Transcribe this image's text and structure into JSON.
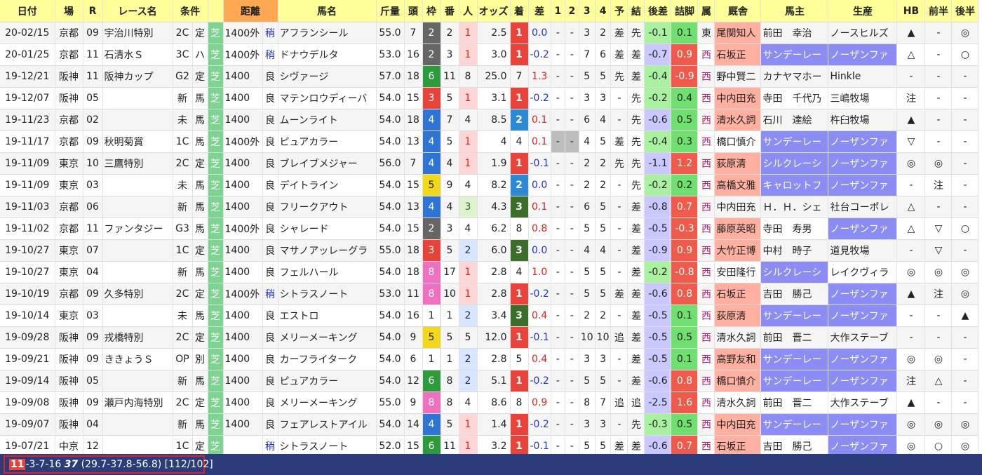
{
  "headers": {
    "date": "日付",
    "place": "場",
    "race_no": "R",
    "race_name": "レース名",
    "cond": "条件",
    "dist": "距離",
    "horse": "馬名",
    "weight": "斤量",
    "heads": "頭",
    "frame": "枠",
    "num": "番",
    "pop": "人",
    "odds": "オッズ",
    "finish": "着",
    "diff": "差",
    "c1": "1",
    "c2": "2",
    "c3": "3",
    "c4": "4",
    "pred": "予",
    "result": "結",
    "late_diff": "後差",
    "agari": "詰脚",
    "belong": "属",
    "stable": "厩舎",
    "owner": "馬主",
    "breeder": "生産",
    "hb": "HB",
    "first_half": "前半",
    "second_half": "後半"
  },
  "rows": [
    {
      "date": "20-02/15",
      "place": "京都",
      "r": "09",
      "name": "宇治川特別",
      "grade": "2C",
      "kind": "定",
      "surface": "芝",
      "dist": "1400外",
      "track": "稍",
      "horse": "アフランシール",
      "weight": "55.0",
      "heads": "7",
      "frame": "2",
      "num": "2",
      "pop": "1",
      "odds": "2.5",
      "finish": "1",
      "diff": "0.0",
      "c1": "-",
      "c2": "-",
      "c3": "3",
      "c4": "2",
      "pred": "差",
      "result": "先",
      "late": "-0.1",
      "agari": "0.1",
      "belong": "東",
      "stable": "尾関知人",
      "owner": "前田　幸治",
      "breeder": "ノースヒルズ",
      "hb": "▲",
      "fh": "-",
      "sh": "◎"
    },
    {
      "date": "20-01/25",
      "place": "京都",
      "r": "11",
      "name": "石清水Ｓ",
      "grade": "3C",
      "kind": "ハ",
      "surface": "芝",
      "dist": "1400外",
      "track": "稍",
      "horse": "ドナウデルタ",
      "weight": "53.0",
      "heads": "16",
      "frame": "2",
      "num": "3",
      "pop": "1",
      "odds": "3.0",
      "finish": "1",
      "diff": "-0.2",
      "c1": "-",
      "c2": "-",
      "c3": "7",
      "c4": "6",
      "pred": "差",
      "result": "差",
      "late": "-0.7",
      "agari": "0.9",
      "belong": "西",
      "stable": "石坂正",
      "owner": "サンデーレー",
      "breeder": "ノーザンファ",
      "hb": "△",
      "fh": "-",
      "sh": "○"
    },
    {
      "date": "19-12/21",
      "place": "阪神",
      "r": "11",
      "name": "阪神カップ",
      "grade": "G2",
      "kind": "定",
      "surface": "芝",
      "dist": "1400",
      "track": "良",
      "horse": "シヴァージ",
      "weight": "57.0",
      "heads": "18",
      "frame": "6",
      "num": "11",
      "pop": "8",
      "odds": "25.0",
      "finish": "7",
      "diff": "1.3",
      "c1": "-",
      "c2": "-",
      "c3": "5",
      "c4": "5",
      "pred": "先",
      "result": "差",
      "late": "-0.4",
      "agari": "-0.9",
      "belong": "西",
      "stable": "野中賢二",
      "owner": "カナヤマホー",
      "breeder": "Hinkle",
      "hb": "-",
      "fh": "-",
      "sh": "-"
    },
    {
      "date": "19-12/07",
      "place": "阪神",
      "r": "05",
      "name": "",
      "grade": "新",
      "kind": "馬",
      "surface": "芝",
      "dist": "1400",
      "track": "良",
      "horse": "マテンロウディーバ",
      "weight": "54.0",
      "heads": "15",
      "frame": "3",
      "num": "5",
      "pop": "1",
      "odds": "3.1",
      "finish": "1",
      "diff": "-0.2",
      "c1": "-",
      "c2": "-",
      "c3": "3",
      "c4": "3",
      "pred": "-",
      "result": "先",
      "late": "-0.2",
      "agari": "0.4",
      "belong": "西",
      "stable": "中内田充",
      "owner": "寺田　千代乃",
      "breeder": "三嶋牧場",
      "hb": "注",
      "fh": "-",
      "sh": "-"
    },
    {
      "date": "19-11/23",
      "place": "京都",
      "r": "02",
      "name": "",
      "grade": "未",
      "kind": "馬",
      "surface": "芝",
      "dist": "1400",
      "track": "良",
      "horse": "ムーンライト",
      "weight": "54.0",
      "heads": "18",
      "frame": "4",
      "num": "7",
      "pop": "4",
      "odds": "8.5",
      "finish": "2",
      "diff": "0.1",
      "c1": "-",
      "c2": "-",
      "c3": "6",
      "c4": "4",
      "pred": "-",
      "result": "先",
      "late": "-0.6",
      "agari": "0.5",
      "belong": "西",
      "stable": "清水久詞",
      "owner": "石川　達絵",
      "breeder": "杵臼牧場",
      "hb": "▲",
      "fh": "-",
      "sh": "-"
    },
    {
      "date": "19-11/17",
      "place": "京都",
      "r": "09",
      "name": "秋明菊賞",
      "grade": "1C",
      "kind": "馬",
      "surface": "芝",
      "dist": "1400外",
      "track": "良",
      "horse": "ピュアカラー",
      "weight": "54.0",
      "heads": "13",
      "frame": "4",
      "num": "5",
      "pop": "1",
      "odds": "4",
      "finish": "4",
      "diff": "0.1",
      "c1": "-",
      "c2": "-",
      "c3": "4",
      "c4": "5",
      "pred": "差",
      "result": "先",
      "late": "-0.4",
      "agari": "0.3",
      "belong": "西",
      "stable": "橋口慎介",
      "owner": "サンデーレー",
      "breeder": "ノーザンファ",
      "hb": "▽",
      "fh": "-",
      "sh": "-"
    },
    {
      "date": "19-11/09",
      "place": "東京",
      "r": "10",
      "name": "三鷹特別",
      "grade": "2C",
      "kind": "定",
      "surface": "芝",
      "dist": "1400",
      "track": "良",
      "horse": "ブレイブメジャー",
      "weight": "56.0",
      "heads": "7",
      "frame": "4",
      "num": "4",
      "pop": "1",
      "odds": "1.9",
      "finish": "1",
      "diff": "-0.1",
      "c1": "-",
      "c2": "-",
      "c3": "2",
      "c4": "2",
      "pred": "先",
      "result": "先",
      "late": "-1.1",
      "agari": "1.2",
      "belong": "西",
      "stable": "荻原清",
      "owner": "シルクレーシ",
      "breeder": "ノーザンファ",
      "hb": "◎",
      "fh": "◎",
      "sh": "-"
    },
    {
      "date": "19-11/09",
      "place": "東京",
      "r": "03",
      "name": "",
      "grade": "未",
      "kind": "馬",
      "surface": "芝",
      "dist": "1400",
      "track": "良",
      "horse": "デイトライン",
      "weight": "54.0",
      "heads": "15",
      "frame": "5",
      "num": "9",
      "pop": "4",
      "odds": "8.2",
      "finish": "2",
      "diff": "0.0",
      "c1": "-",
      "c2": "-",
      "c3": "2",
      "c4": "2",
      "pred": "-",
      "result": "先",
      "late": "-0.2",
      "agari": "0.2",
      "belong": "西",
      "stable": "高橋文雅",
      "owner": "キャロットフ",
      "breeder": "ノーザンファ",
      "hb": "-",
      "fh": "注",
      "sh": "-"
    },
    {
      "date": "19-11/03",
      "place": "京都",
      "r": "06",
      "name": "",
      "grade": "新",
      "kind": "馬",
      "surface": "芝",
      "dist": "1400",
      "track": "良",
      "horse": "フリークアウト",
      "weight": "54.0",
      "heads": "13",
      "frame": "4",
      "num": "4",
      "pop": "3",
      "odds": "4.3",
      "finish": "3",
      "diff": "0.1",
      "c1": "-",
      "c2": "-",
      "c3": "6",
      "c4": "5",
      "pred": "-",
      "result": "差",
      "late": "-0.8",
      "agari": "0.7",
      "belong": "西",
      "stable": "中内田充",
      "owner": "Ｈ．Ｈ．シェ",
      "breeder": "社台コーポレ",
      "hb": "△",
      "fh": "-",
      "sh": "-"
    },
    {
      "date": "19-11/02",
      "place": "京都",
      "r": "11",
      "name": "ファンタジー",
      "grade": "G3",
      "kind": "馬",
      "surface": "芝",
      "dist": "1400外",
      "track": "良",
      "horse": "シャレード",
      "weight": "54.0",
      "heads": "15",
      "frame": "2",
      "num": "3",
      "pop": "4",
      "odds": "6.2",
      "finish": "8",
      "diff": "0.8",
      "c1": "-",
      "c2": "-",
      "c3": "5",
      "c4": "5",
      "pred": "-",
      "result": "差",
      "late": "-0.5",
      "agari": "-0.3",
      "belong": "西",
      "stable": "藤原英昭",
      "owner": "寺田　寿男",
      "breeder": "ノーザンファ",
      "hb": "△",
      "fh": "▽",
      "sh": "○"
    },
    {
      "date": "19-10/27",
      "place": "東京",
      "r": "07",
      "name": "",
      "grade": "1C",
      "kind": "定",
      "surface": "芝",
      "dist": "1400",
      "track": "良",
      "horse": "マサノアッレーグラ",
      "weight": "55.0",
      "heads": "18",
      "frame": "3",
      "num": "5",
      "pop": "2",
      "odds": "6.0",
      "finish": "3",
      "diff": "0.0",
      "c1": "-",
      "c2": "-",
      "c3": "4",
      "c4": "4",
      "pred": "-",
      "result": "差",
      "late": "-0.9",
      "agari": "0.9",
      "belong": "西",
      "stable": "大竹正博",
      "owner": "中村　時子",
      "breeder": "道見牧場",
      "hb": "-",
      "fh": "▽",
      "sh": "-"
    },
    {
      "date": "19-10/27",
      "place": "東京",
      "r": "04",
      "name": "",
      "grade": "新",
      "kind": "馬",
      "surface": "芝",
      "dist": "1400",
      "track": "良",
      "horse": "フェルハール",
      "weight": "54.0",
      "heads": "18",
      "frame": "8",
      "num": "17",
      "pop": "1",
      "odds": "2.8",
      "finish": "4",
      "diff": "1.0",
      "c1": "-",
      "c2": "-",
      "c3": "5",
      "c4": "5",
      "pred": "-",
      "result": "差",
      "late": "-0.2",
      "agari": "-0.8",
      "belong": "西",
      "stable": "安田隆行",
      "owner": "シルクレーシ",
      "breeder": "レイクヴィラ",
      "hb": "◎",
      "fh": "◎",
      "sh": "◎"
    },
    {
      "date": "19-10/19",
      "place": "京都",
      "r": "09",
      "name": "久多特別",
      "grade": "2C",
      "kind": "定",
      "surface": "芝",
      "dist": "1400外",
      "track": "稍",
      "horse": "シトラスノート",
      "weight": "53.0",
      "heads": "11",
      "frame": "8",
      "num": "10",
      "pop": "1",
      "odds": "2.8",
      "finish": "1",
      "diff": "-0.2",
      "c1": "-",
      "c2": "-",
      "c3": "5",
      "c4": "5",
      "pred": "差",
      "result": "差",
      "late": "-0.6",
      "agari": "0.8",
      "belong": "西",
      "stable": "石坂正",
      "owner": "吉田　勝己",
      "breeder": "ノーザンファ",
      "hb": "▲",
      "fh": "注",
      "sh": "◎"
    },
    {
      "date": "19-10/14",
      "place": "東京",
      "r": "03",
      "name": "",
      "grade": "未",
      "kind": "馬",
      "surface": "芝",
      "dist": "1400",
      "track": "良",
      "horse": "エストロ",
      "weight": "54.0",
      "heads": "16",
      "frame": "1",
      "num": "1",
      "pop": "2",
      "odds": "3.4",
      "finish": "3",
      "diff": "0.4",
      "c1": "-",
      "c2": "-",
      "c3": "2",
      "c4": "2",
      "pred": "-",
      "result": "差",
      "late": "-0.5",
      "agari": "0.1",
      "belong": "西",
      "stable": "荻原清",
      "owner": "サンデーレー",
      "breeder": "ノーザンファ",
      "hb": "-",
      "fh": "-",
      "sh": "▲"
    },
    {
      "date": "19-09/28",
      "place": "阪神",
      "r": "09",
      "name": "戎橋特別",
      "grade": "2C",
      "kind": "定",
      "surface": "芝",
      "dist": "1400",
      "track": "良",
      "horse": "メリーメーキング",
      "weight": "54.0",
      "heads": "9",
      "frame": "5",
      "num": "5",
      "pop": "5",
      "odds": "12.0",
      "finish": "1",
      "diff": "-0.1",
      "c1": "-",
      "c2": "-",
      "c3": "10",
      "c4": "10",
      "pred": "追",
      "result": "差",
      "late": "-0.5",
      "agari": "0.5",
      "belong": "西",
      "stable": "清水久詞",
      "owner": "前田　晋二",
      "breeder": "大作ステーブ",
      "hb": "-",
      "fh": "-",
      "sh": "-"
    },
    {
      "date": "19-09/21",
      "place": "阪神",
      "r": "09",
      "name": "ききょうＳ",
      "grade": "OP",
      "kind": "別",
      "surface": "芝",
      "dist": "1400",
      "track": "良",
      "horse": "カーフライターク",
      "weight": "54.0",
      "heads": "6",
      "frame": "1",
      "num": "1",
      "pop": "2",
      "odds": "2.8",
      "finish": "5",
      "diff": "0.4",
      "c1": "-",
      "c2": "-",
      "c3": "3",
      "c4": "3",
      "pred": "-",
      "result": "差",
      "late": "-0.5",
      "agari": "0.1",
      "belong": "西",
      "stable": "高野友和",
      "owner": "サンデーレー",
      "breeder": "ノーザンファ",
      "hb": "◎",
      "fh": "◎",
      "sh": "-"
    },
    {
      "date": "19-09/14",
      "place": "阪神",
      "r": "05",
      "name": "",
      "grade": "新",
      "kind": "馬",
      "surface": "芝",
      "dist": "1400",
      "track": "良",
      "horse": "ピュアカラー",
      "weight": "54.0",
      "heads": "12",
      "frame": "6",
      "num": "8",
      "pop": "2",
      "odds": "5.1",
      "finish": "1",
      "diff": "-0.2",
      "c1": "-",
      "c2": "-",
      "c3": "5",
      "c4": "5",
      "pred": "-",
      "result": "差",
      "late": "-0.6",
      "agari": "0.8",
      "belong": "西",
      "stable": "橋口慎介",
      "owner": "サンデーレー",
      "breeder": "ノーザンファ",
      "hb": "注",
      "fh": "△",
      "sh": "-"
    },
    {
      "date": "19-09/08",
      "place": "阪神",
      "r": "09",
      "name": "瀬戸内海特別",
      "grade": "2C",
      "kind": "定",
      "surface": "芝",
      "dist": "1400",
      "track": "良",
      "horse": "メリーメーキング",
      "weight": "55.0",
      "heads": "9",
      "frame": "8",
      "num": "8",
      "pop": "4",
      "odds": "8.6",
      "finish": "8",
      "diff": "0.9",
      "c1": "-",
      "c2": "-",
      "c3": "8",
      "c4": "7",
      "pred": "追",
      "result": "追",
      "late": "-2.5",
      "agari": "1.6",
      "belong": "西",
      "stable": "清水久詞",
      "owner": "前田　晋二",
      "breeder": "大作ステーブ",
      "hb": "▲",
      "fh": "-",
      "sh": "-"
    },
    {
      "date": "19-09/07",
      "place": "阪神",
      "r": "04",
      "name": "",
      "grade": "新",
      "kind": "馬",
      "surface": "芝",
      "dist": "1400",
      "track": "良",
      "horse": "フェアレストアイル",
      "weight": "54.0",
      "heads": "14",
      "frame": "4",
      "num": "5",
      "pop": "1",
      "odds": "1.4",
      "finish": "1",
      "diff": "-0.2",
      "c1": "-",
      "c2": "-",
      "c3": "3",
      "c4": "3",
      "pred": "-",
      "result": "先",
      "late": "-0.3",
      "agari": "0.5",
      "belong": "西",
      "stable": "中内田充",
      "owner": "サンデーレー",
      "breeder": "ノーザンファ",
      "hb": "◎",
      "fh": "◎",
      "sh": "◎"
    },
    {
      "date": "19-07/21",
      "place": "中京",
      "r": "12",
      "name": "",
      "grade": "1C",
      "kind": "定",
      "surface": "芝",
      "dist": "",
      "track": "稍",
      "horse": "シトラスノート",
      "weight": "52.0",
      "heads": "15",
      "frame": "6",
      "num": "11",
      "pop": "1",
      "odds": "3.2",
      "finish": "1",
      "diff": "-0.1",
      "c1": "-",
      "c2": "-",
      "c3": "5",
      "c4": "5",
      "pred": "差",
      "result": "差",
      "late": "-0.6",
      "agari": "0.7",
      "belong": "西",
      "stable": "石坂正",
      "owner": "吉田　勝己",
      "breeder": "ノーザンファ",
      "hb": "◎",
      "fh": "○",
      "sh": "◎"
    }
  ],
  "footer": {
    "badge": "11",
    "seq": "-3-7-16 ",
    "bold": "37",
    "rest": " (29.7-37.8-56.8) [112/102]"
  },
  "colors": {
    "header": "#ffff99",
    "dist_header": "#ffa852",
    "turf": "#7dd490",
    "footer": "#2a3d7a",
    "highlight_box": "#e51e1e"
  }
}
